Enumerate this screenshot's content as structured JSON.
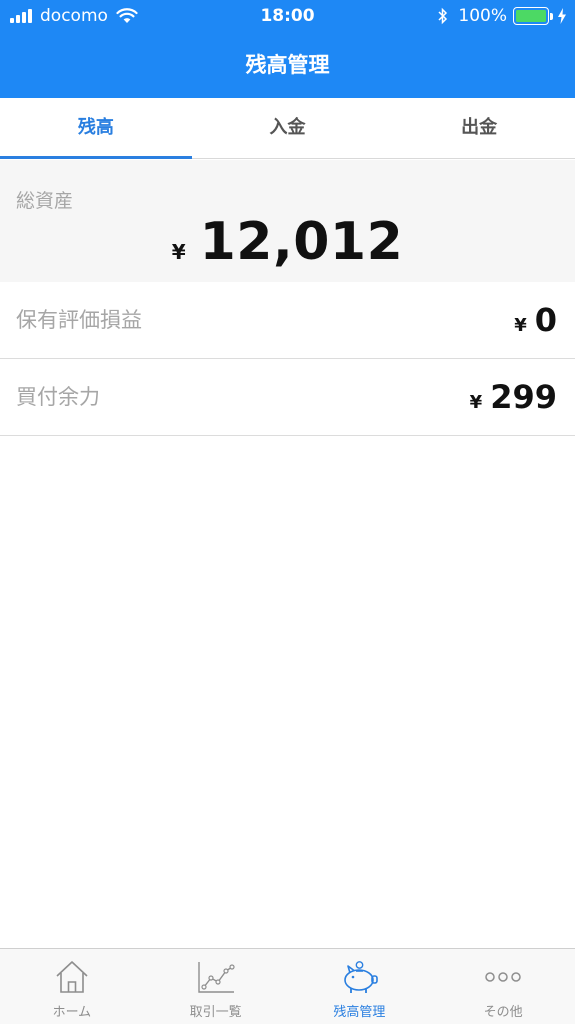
{
  "status_bar": {
    "carrier": "docomo",
    "time": "18:00",
    "battery": "100%",
    "icons": [
      "signal-icon",
      "wifi-icon",
      "bluetooth-icon",
      "battery-icon",
      "charging-bolt-icon"
    ]
  },
  "navbar": {
    "title": "残高管理"
  },
  "tabs": [
    {
      "label": "残高",
      "active": true
    },
    {
      "label": "入金",
      "active": false
    },
    {
      "label": "出金",
      "active": false
    }
  ],
  "total_assets": {
    "label": "総資産",
    "currency": "¥",
    "value": "12,012"
  },
  "rows": [
    {
      "label": "保有評価損益",
      "currency": "¥",
      "value": "0"
    },
    {
      "label": "買付余力",
      "currency": "¥",
      "value": "299"
    }
  ],
  "tabbar": {
    "items": [
      {
        "label": "ホーム",
        "icon": "home-icon",
        "active": false
      },
      {
        "label": "取引一覧",
        "icon": "chart-icon",
        "active": false
      },
      {
        "label": "残高管理",
        "icon": "piggy-bank-icon",
        "active": true
      },
      {
        "label": "その他",
        "icon": "more-icon",
        "active": false
      }
    ]
  },
  "colors": {
    "header_blue": "#1e88f5",
    "accent_blue": "#2a7fe0",
    "battery_green": "#4cd964",
    "label_gray": "#a6a6a6"
  }
}
